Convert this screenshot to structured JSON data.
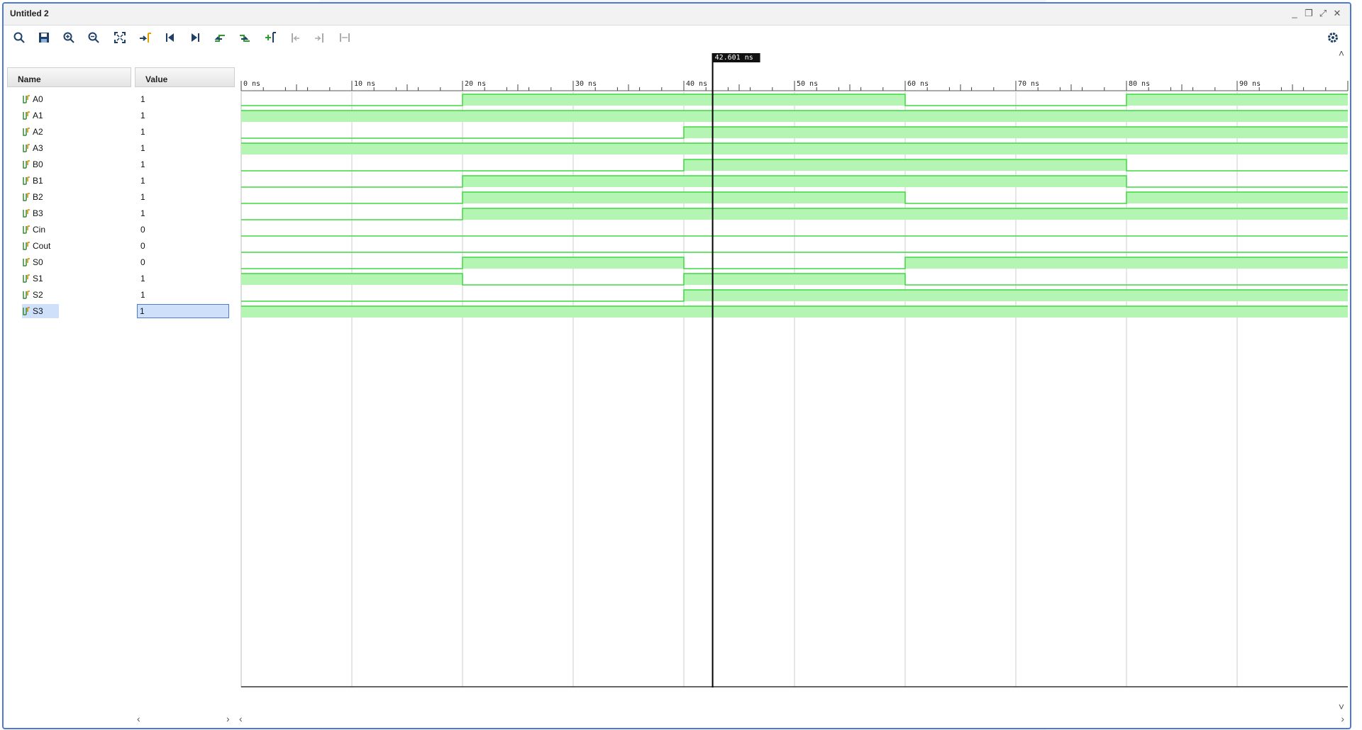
{
  "window": {
    "title": "Untitled 2"
  },
  "toolbar": {
    "tools": [
      "search-icon",
      "save-icon",
      "zoom-in-icon",
      "zoom-out-icon",
      "zoom-fit-icon",
      "go-to-cursor-icon",
      "go-to-start-icon",
      "go-to-end-icon",
      "previous-transition-icon",
      "next-transition-icon",
      "add-marker-icon",
      "previous-marker-icon",
      "next-marker-icon",
      "swap-cursors-icon"
    ]
  },
  "columns": {
    "name": "Name",
    "value": "Value"
  },
  "signals": [
    {
      "name": "A0",
      "value": "1"
    },
    {
      "name": "A1",
      "value": "1"
    },
    {
      "name": "A2",
      "value": "1"
    },
    {
      "name": "A3",
      "value": "1"
    },
    {
      "name": "B0",
      "value": "1"
    },
    {
      "name": "B1",
      "value": "1"
    },
    {
      "name": "B2",
      "value": "1"
    },
    {
      "name": "B3",
      "value": "1"
    },
    {
      "name": "Cin",
      "value": "0"
    },
    {
      "name": "Cout",
      "value": "0"
    },
    {
      "name": "S0",
      "value": "0"
    },
    {
      "name": "S1",
      "value": "1"
    },
    {
      "name": "S2",
      "value": "1"
    },
    {
      "name": "S3",
      "value": "1"
    }
  ],
  "selected_signal": "S3",
  "timeline": {
    "ticks": [
      "0 ns",
      "10 ns",
      "20 ns",
      "30 ns",
      "40 ns",
      "50 ns",
      "60 ns",
      "70 ns",
      "80 ns",
      "90 ns"
    ],
    "range_ns": [
      0,
      100
    ],
    "cursor_ns": 42.601,
    "cursor_label": "42.601 ns"
  },
  "waves": {
    "A0": [
      [
        0,
        0
      ],
      [
        20,
        1
      ],
      [
        60,
        0
      ],
      [
        80,
        1
      ]
    ],
    "A1": [
      [
        0,
        1
      ]
    ],
    "A2": [
      [
        0,
        0
      ],
      [
        40,
        1
      ]
    ],
    "A3": [
      [
        0,
        1
      ]
    ],
    "B0": [
      [
        0,
        0
      ],
      [
        40,
        1
      ],
      [
        80,
        0
      ]
    ],
    "B1": [
      [
        0,
        0
      ],
      [
        20,
        1
      ],
      [
        80,
        0
      ]
    ],
    "B2": [
      [
        0,
        0
      ],
      [
        20,
        1
      ],
      [
        60,
        0
      ],
      [
        80,
        1
      ]
    ],
    "B3": [
      [
        0,
        0
      ],
      [
        20,
        1
      ]
    ],
    "Cin": [
      [
        0,
        0
      ]
    ],
    "Cout": [
      [
        0,
        0
      ]
    ],
    "S0": [
      [
        0,
        0
      ],
      [
        20,
        1
      ],
      [
        40,
        0
      ],
      [
        60,
        1
      ]
    ],
    "S1": [
      [
        0,
        1
      ],
      [
        20,
        0
      ],
      [
        40,
        1
      ],
      [
        60,
        0
      ]
    ],
    "S2": [
      [
        0,
        0
      ],
      [
        40,
        1
      ]
    ],
    "S3": [
      [
        0,
        1
      ]
    ]
  },
  "colors": {
    "wave_high_fill": "#b4f5b4",
    "wave_line": "#3ed83e",
    "cursor": "#000000",
    "selection": "#cfe0fb"
  }
}
